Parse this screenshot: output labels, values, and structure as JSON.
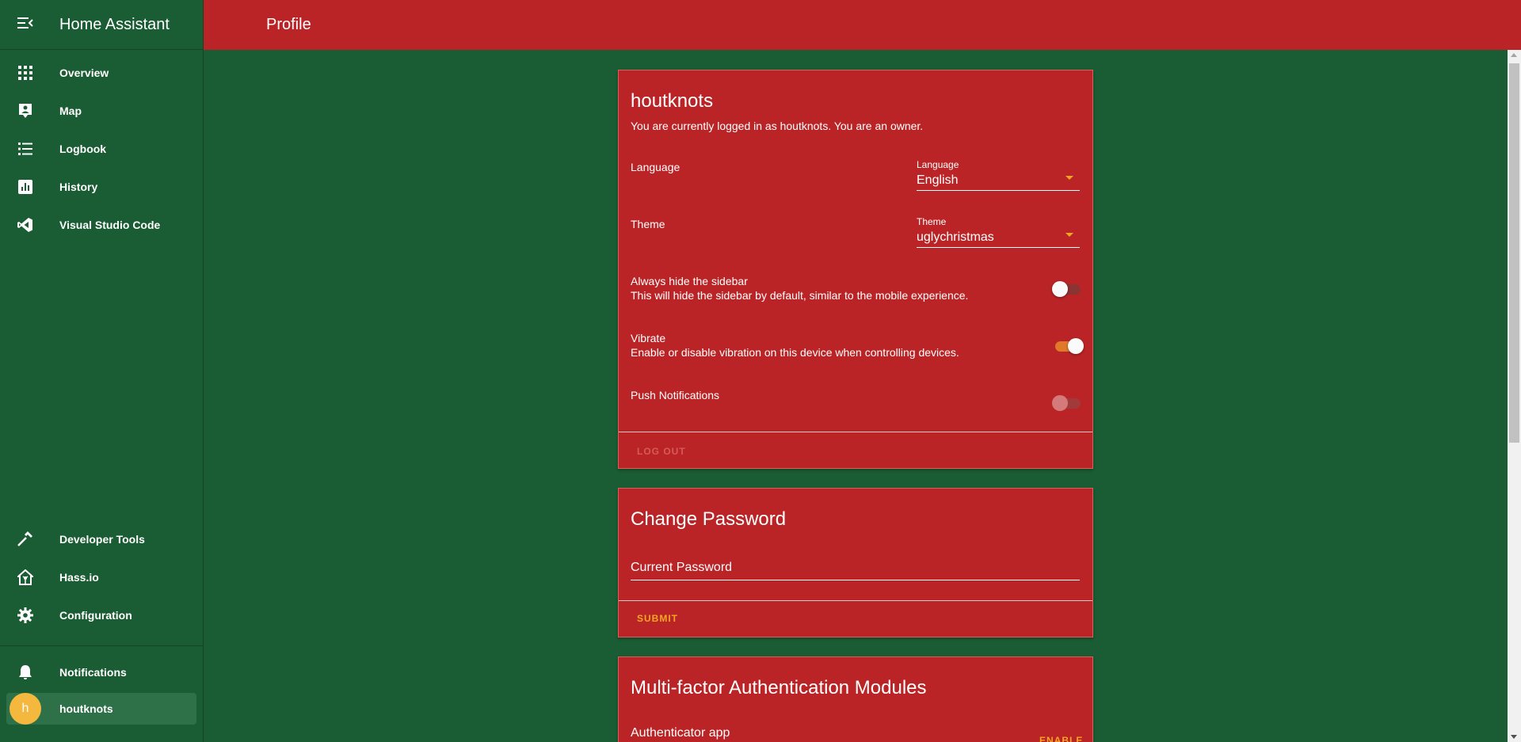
{
  "sidebar": {
    "title": "Home Assistant",
    "items": [
      {
        "label": "Overview",
        "icon": "grid-icon"
      },
      {
        "label": "Map",
        "icon": "map-account-icon"
      },
      {
        "label": "Logbook",
        "icon": "list-icon"
      },
      {
        "label": "History",
        "icon": "chart-icon"
      },
      {
        "label": "Visual Studio Code",
        "icon": "vscode-icon"
      }
    ],
    "bottom_items": [
      {
        "label": "Developer Tools",
        "icon": "hammer-icon"
      },
      {
        "label": "Hass.io",
        "icon": "hassio-icon"
      },
      {
        "label": "Configuration",
        "icon": "gear-icon"
      }
    ],
    "notifications_label": "Notifications",
    "user": {
      "initial": "h",
      "name": "houtknots"
    }
  },
  "topbar": {
    "title": "Profile"
  },
  "profile_card": {
    "username": "houtknots",
    "logged_in_text": "You are currently logged in as houtknots. You are an owner.",
    "language": {
      "row_label": "Language",
      "field_label": "Language",
      "value": "English"
    },
    "theme": {
      "row_label": "Theme",
      "field_label": "Theme",
      "value": "uglychristmas"
    },
    "hide_sidebar": {
      "label": "Always hide the sidebar",
      "description": "This will hide the sidebar by default, similar to the mobile experience.",
      "enabled": false
    },
    "vibrate": {
      "label": "Vibrate",
      "description": "Enable or disable vibration on this device when controlling devices.",
      "enabled": true
    },
    "push": {
      "label": "Push Notifications",
      "enabled": false,
      "disabled": true
    },
    "logout_label": "LOG OUT"
  },
  "password_card": {
    "title": "Change Password",
    "current_password_label": "Current Password",
    "submit_label": "SUBMIT"
  },
  "mfa_card": {
    "title": "Multi-factor Authentication Modules",
    "module_name": "Authenticator app",
    "enable_label": "ENABLE"
  },
  "colors": {
    "sidebar_bg": "#1a5c33",
    "card_bg": "#bb2426",
    "accent": "#f5a623",
    "avatar": "#f4b83f"
  }
}
